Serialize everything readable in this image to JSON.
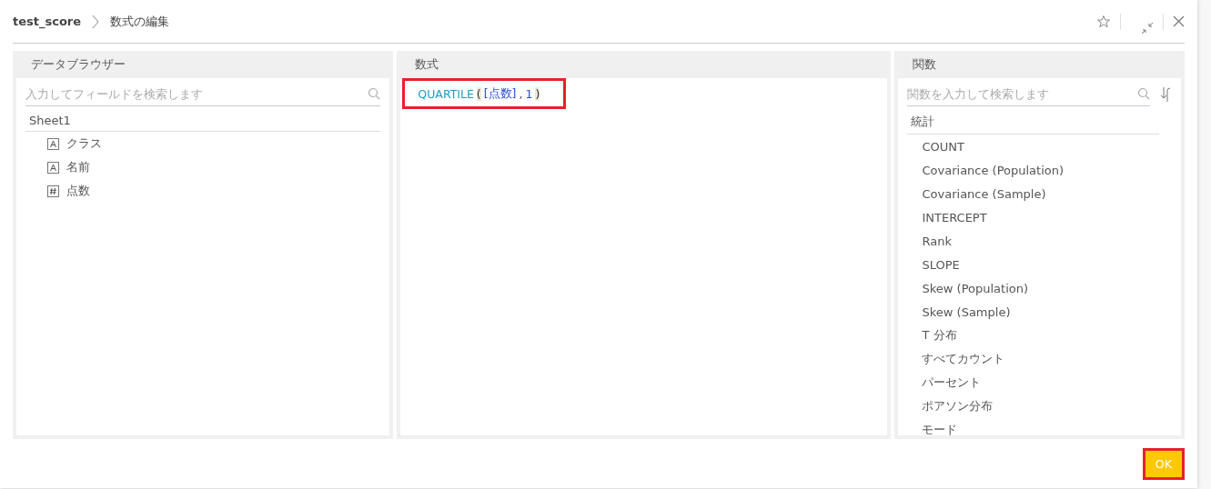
{
  "breadcrumb": [
    {
      "label": "test_score",
      "bold": true
    },
    {
      "label": "数式の編集",
      "bold": false
    }
  ],
  "data_browser": {
    "title": "データブラウザー",
    "search": {
      "placeholder": "入力してフィールドを検索します"
    },
    "sheet": "Sheet1",
    "fields": [
      {
        "name": "クラス",
        "kind": "text"
      },
      {
        "name": "名前",
        "kind": "text"
      },
      {
        "name": "点数",
        "kind": "number"
      }
    ]
  },
  "formula": {
    "title": "数式",
    "highlighted": true,
    "tokens": [
      {
        "text": "QUARTILE",
        "kind": "function"
      },
      {
        "text": "(",
        "kind": "paren"
      },
      {
        "text": "[点数]",
        "kind": "field"
      },
      {
        "text": ",",
        "kind": "operator"
      },
      {
        "text": "1",
        "kind": "number"
      },
      {
        "text": ")",
        "kind": "paren"
      }
    ]
  },
  "functions": {
    "title": "関数",
    "search": {
      "placeholder": "関数を入力して検索します"
    },
    "category": "統計",
    "items": [
      "COUNT",
      "Covariance (Population)",
      "Covariance (Sample)",
      "INTERCEPT",
      "Rank",
      "SLOPE",
      "Skew (Population)",
      "Skew (Sample)",
      "T 分布",
      "すべてカウント",
      "パーセント",
      "ポアソン分布",
      "モード"
    ]
  },
  "ok_button": {
    "label": "OK",
    "highlighted": true
  }
}
